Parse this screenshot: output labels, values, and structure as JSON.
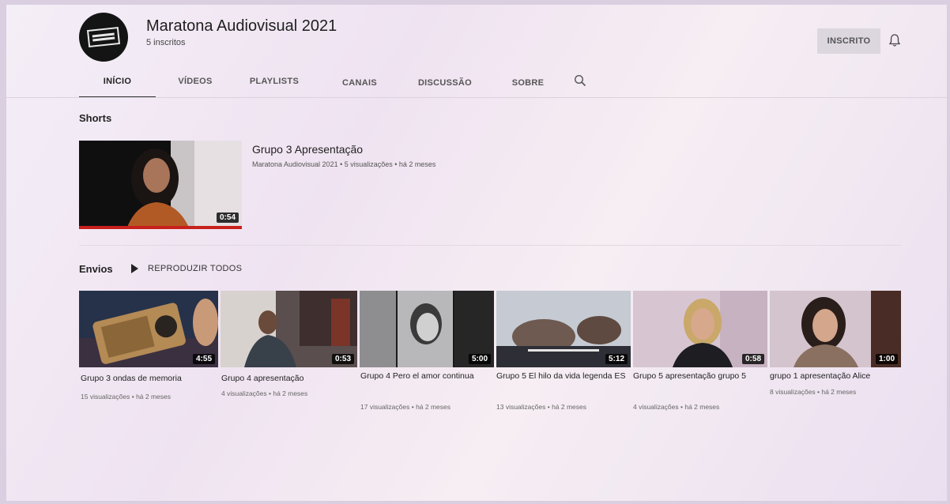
{
  "channel": {
    "name": "Maratona Audiovisual 2021",
    "subscribers": "5 inscritos",
    "subscribe_label": "INSCRITO"
  },
  "tabs": [
    {
      "label": "INÍCIO",
      "active": true
    },
    {
      "label": "VÍDEOS"
    },
    {
      "label": "PLAYLISTS"
    },
    {
      "label": "CANAIS"
    },
    {
      "label": "DISCUSSÃO"
    },
    {
      "label": "SOBRE"
    }
  ],
  "shorts": {
    "section_title": "Shorts",
    "video": {
      "title": "Grupo 3 Apresentação",
      "meta": "Maratona Audiovisual 2021 • 5 visualizações • há 2 meses",
      "duration": "0:54"
    }
  },
  "uploads": {
    "section_title": "Envios",
    "play_all_label": "REPRODUZIR TODOS",
    "videos": [
      {
        "title": "Grupo 3 ondas de memoria",
        "meta": "15 visualizações • há 2 meses",
        "duration": "4:55"
      },
      {
        "title": "Grupo 4 apresentação",
        "meta": "4 visualizações • há 2 meses",
        "duration": "0:53"
      },
      {
        "title": "Grupo 4 Pero el amor continua",
        "meta": "17 visualizações • há 2 meses",
        "duration": "5:00"
      },
      {
        "title": "Grupo 5 El hilo da vida legenda ES",
        "meta": "13 visualizações • há 2 meses",
        "duration": "5:12"
      },
      {
        "title": "Grupo 5 apresentação grupo 5",
        "meta": "4 visualizações • há 2 meses",
        "duration": "0:58"
      },
      {
        "title": "grupo 1 apresentação Alice",
        "meta": "8 visualizações • há 2 meses",
        "duration": "1:00"
      }
    ]
  },
  "icons": {
    "bell": "bell-icon",
    "search": "search-icon",
    "play": "play-icon"
  },
  "colors": {
    "accent_red": "#c8201c"
  }
}
